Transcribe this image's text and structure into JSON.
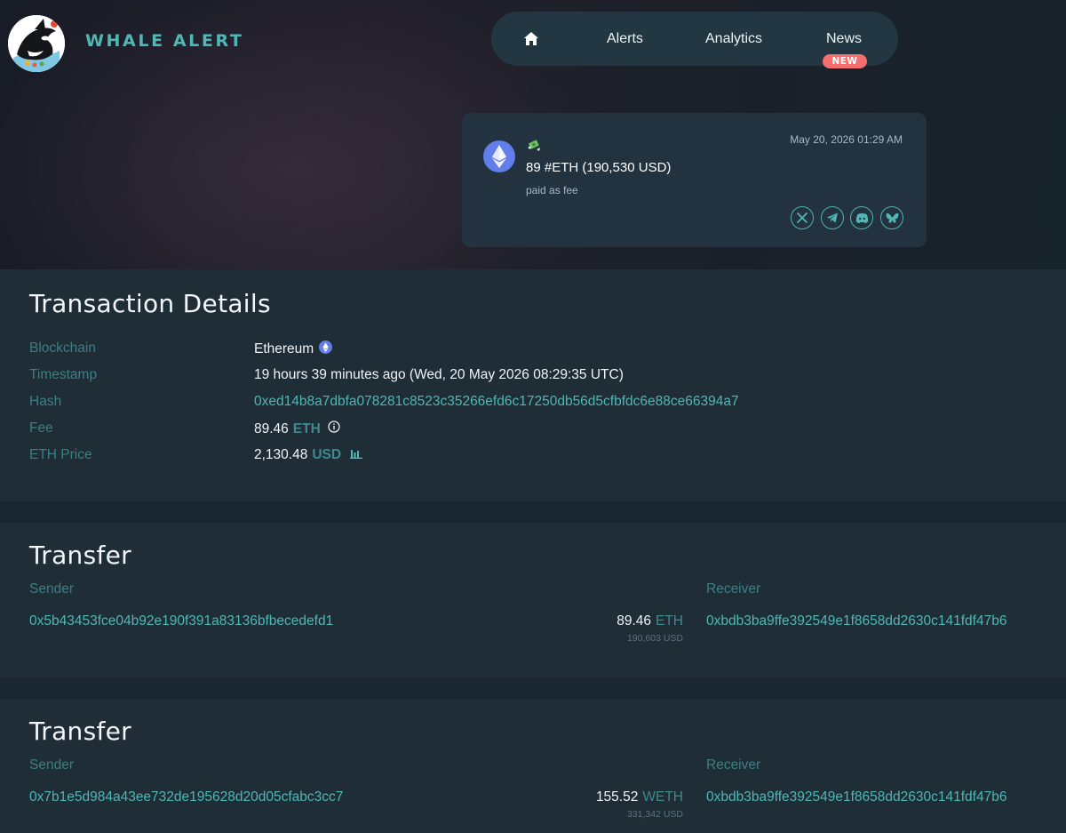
{
  "header": {
    "brand": "WHALE ALERT",
    "nav": {
      "home_icon": "home-icon",
      "alerts": "Alerts",
      "analytics": "Analytics",
      "news": "News",
      "news_badge": "NEW"
    }
  },
  "alert_card": {
    "icon": "ethereum-icon",
    "emoji": "money-with-wings-icon",
    "timestamp": "May 20, 2026 01:29 AM",
    "amount": "89 #ETH (190,530 USD)",
    "subtitle": "paid as fee",
    "share_icons": [
      "x-icon",
      "telegram-icon",
      "discord-icon",
      "bluesky-icon"
    ]
  },
  "transaction_details": {
    "title": "Transaction Details",
    "rows": [
      {
        "label": "Blockchain",
        "value": "Ethereum"
      },
      {
        "label": "Timestamp",
        "value": "19 hours 39 minutes ago (Wed, 20 May 2026 08:29:35 UTC)"
      },
      {
        "label": "Hash",
        "value": "0xed14b8a7dbfa078281c8523c35266efd6c17250db56d5cfbfdc6e88ce66394a7"
      },
      {
        "label": "Fee",
        "value": "89.46",
        "unit": "ETH"
      },
      {
        "label": "ETH Price",
        "value": "2,130.48",
        "unit": "USD"
      }
    ]
  },
  "transfers": [
    {
      "title": "Transfer",
      "sender_label": "Sender",
      "receiver_label": "Receiver",
      "sender": "0x5b43453fce04b92e190f391a83136bfbecedefd1",
      "amount": "89.46",
      "unit": "ETH",
      "usd": "190,603 USD",
      "receiver": "0xbdb3ba9ffe392549e1f8658dd2630c141fdf47b6"
    },
    {
      "title": "Transfer",
      "sender_label": "Sender",
      "receiver_label": "Receiver",
      "sender": "0x7b1e5d984a43ee732de195628d20d05cfabc3cc7",
      "amount": "155.52",
      "unit": "WETH",
      "usd": "331,342 USD",
      "receiver": "0xbdb3ba9ffe392549e1f8658dd2630c141fdf47b6"
    }
  ],
  "colors": {
    "accent": "#4fb7b4",
    "background": "#1b2731",
    "badge": "#f36f6f",
    "ethereum": "#627eea"
  }
}
